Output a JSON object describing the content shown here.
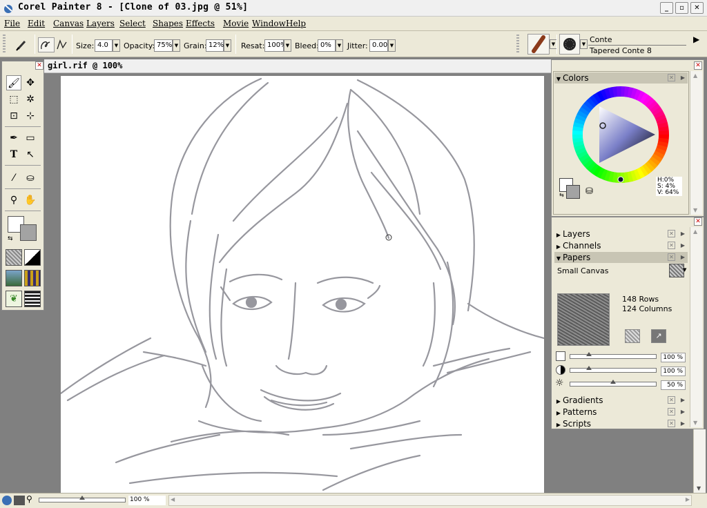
{
  "window": {
    "title": "Corel Painter 8 - [Clone of 03.jpg @ 51%]"
  },
  "menu": [
    "File",
    "Edit",
    "Canvas",
    "Layers",
    "Select",
    "Shapes",
    "Effects",
    "Movie",
    "Window",
    "Help"
  ],
  "property_bar": {
    "size_label": "Size:",
    "size_value": "4.0",
    "opacity_label": "Opacity:",
    "opacity_value": "75%",
    "grain_label": "Grain:",
    "grain_value": "12%",
    "resat_label": "Resat:",
    "resat_value": "100%",
    "bleed_label": "Bleed:",
    "bleed_value": "0%",
    "jitter_label": "Jitter:",
    "jitter_value": "0.00"
  },
  "brush_selector": {
    "category": "Conte",
    "variant": "Tapered Conte 8"
  },
  "document": {
    "title": "girl.rif @ 100%"
  },
  "colors_panel": {
    "title": "Colors",
    "h": "H:0%",
    "s": "S: 4%",
    "v": "V: 64%"
  },
  "palettes": {
    "layers": "Layers",
    "channels": "Channels",
    "papers": "Papers",
    "paper_name": "Small Canvas",
    "rows": "148 Rows",
    "columns": "124 Columns",
    "scale_value": "100 %",
    "contrast_value": "100 %",
    "brightness_value": "50 %",
    "gradients": "Gradients",
    "patterns": "Patterns",
    "scripts": "Scripts"
  },
  "status": {
    "zoom": "100 %"
  },
  "sliders": {
    "paper_scale": 0.22,
    "paper_contrast": 0.22,
    "paper_brightness": 0.5,
    "zoom": 0.5
  },
  "colors": {
    "accent": "#316ac5",
    "canvas_bg": "#ffffff",
    "app_bg": "#808080",
    "panel_bg": "#ece9d8",
    "sketch": "#8c8c94"
  }
}
